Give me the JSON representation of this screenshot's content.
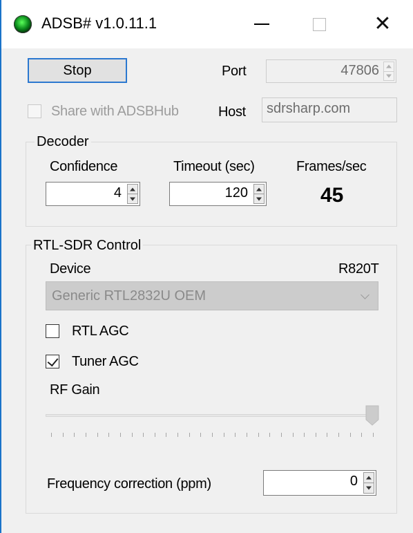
{
  "window": {
    "title": "ADSB# v1.0.11.1",
    "accent_color": "#1a73c9"
  },
  "controls": {
    "stop_label": "Stop",
    "port_label": "Port",
    "port_value": "47806",
    "share_label": "Share with ADSBHub",
    "share_checked": false,
    "host_label": "Host",
    "host_value": "sdrsharp.com"
  },
  "decoder": {
    "title": "Decoder",
    "confidence_label": "Confidence",
    "confidence_value": "4",
    "timeout_label": "Timeout (sec)",
    "timeout_value": "120",
    "fps_label": "Frames/sec",
    "fps_value": "45"
  },
  "rtl": {
    "title": "RTL-SDR Control",
    "device_label": "Device",
    "tuner_model": "R820T",
    "device_selected": "Generic RTL2832U OEM",
    "rtl_agc_label": "RTL AGC",
    "rtl_agc_checked": false,
    "tuner_agc_label": "Tuner AGC",
    "tuner_agc_checked": true,
    "rf_gain_label": "RF Gain",
    "rf_gain_position": 1.0,
    "freq_corr_label": "Frequency correction (ppm)",
    "freq_corr_value": "0"
  },
  "icons": {
    "app": "radar-icon",
    "minimize": "minimize-icon",
    "maximize": "maximize-icon",
    "close": "close-icon"
  }
}
